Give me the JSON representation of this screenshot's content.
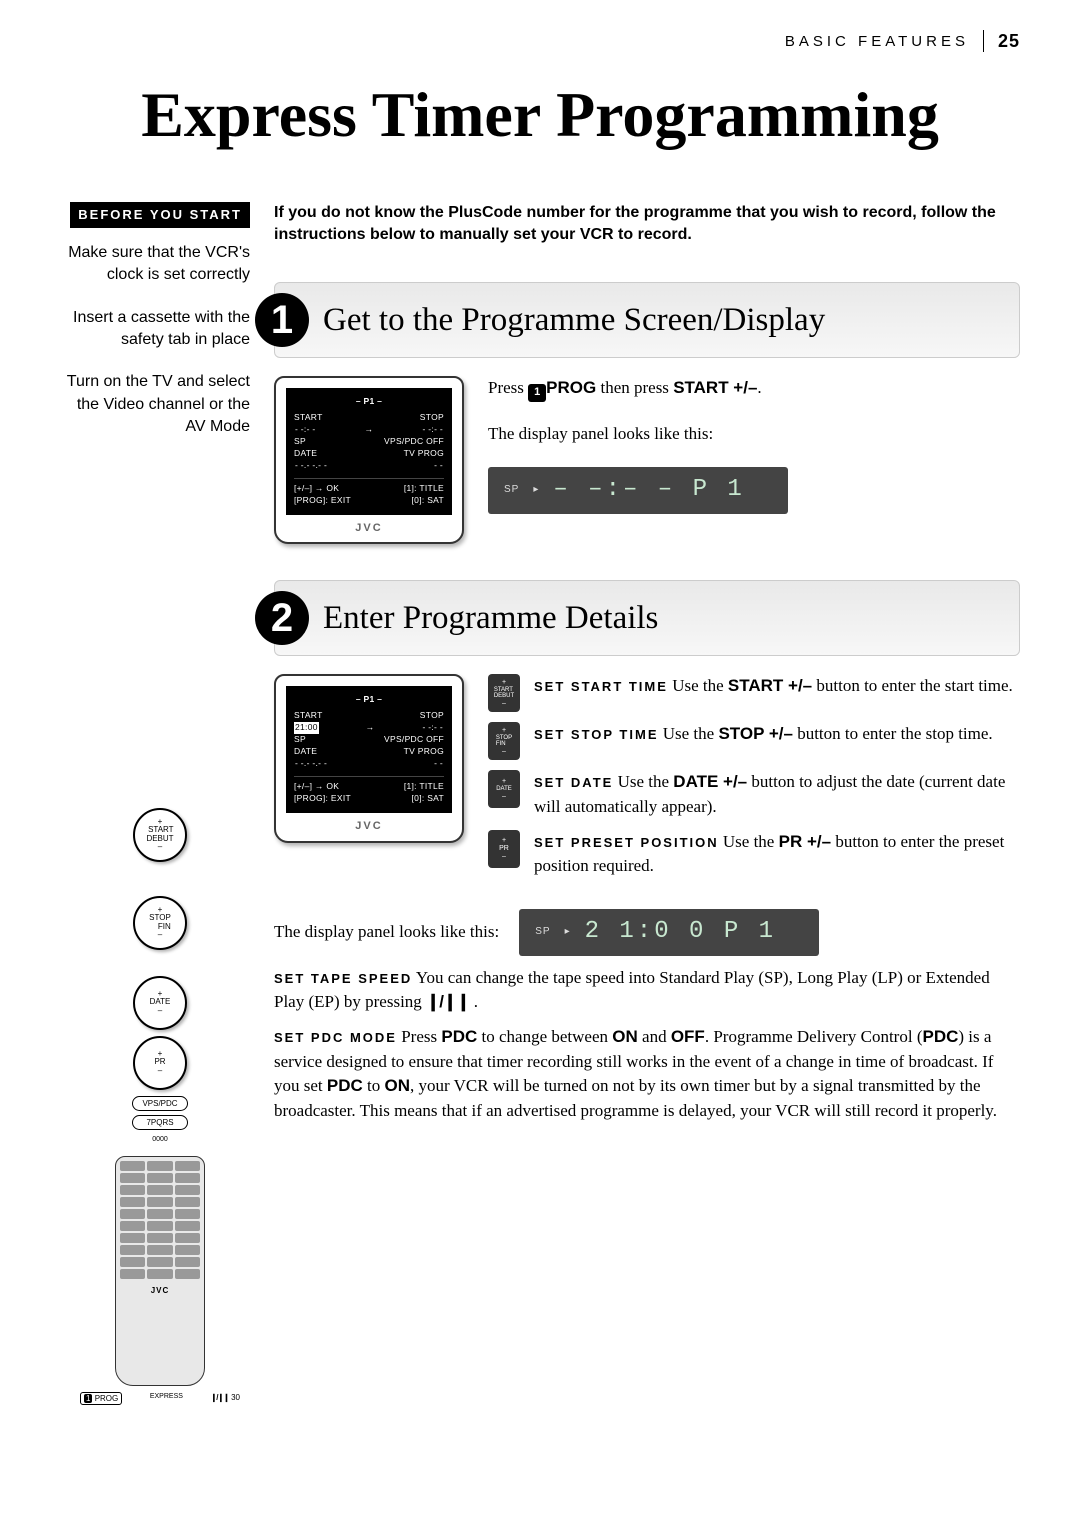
{
  "header": {
    "section": "BASIC FEATURES",
    "page": "25"
  },
  "title": "Express Timer Programming",
  "before": {
    "tag": "BEFORE YOU START",
    "p1": "Make sure that the VCR's clock is set correctly",
    "p2": "Insert a cassette with the safety tab in place",
    "p3": "Turn on the TV and select the Video channel or the AV Mode"
  },
  "intro": "If you do not know the PlusCode number for the programme that you wish to record, follow the instructions below to manually set your VCR to record.",
  "step1": {
    "num": "1",
    "title": "Get to the Programme Screen/Display",
    "press_a": "Press ",
    "prog_label": "PROG",
    "press_b": " then press ",
    "start_pm": "START +/–",
    "press_c": ".",
    "display_label": "The display panel looks like this:",
    "panel_sp": "SP",
    "panel_val": "– –:– –  P 1"
  },
  "tv1": {
    "header": "– P1 –",
    "start_l": "START",
    "stop_l": "STOP",
    "start_v": "- -:- -",
    "stop_v": "- -:- -",
    "sp": "SP",
    "vps": "VPS/PDC OFF",
    "date_l": "DATE",
    "tvprog": "TV PROG",
    "date_v": "- -.- -.- -",
    "tvprog_v": "- -",
    "hint1a": "[+/–] → OK",
    "hint1b": "[1]: TITLE",
    "hint2a": "[PROG]: EXIT",
    "hint2b": "[0]: SAT",
    "logo": "JVC"
  },
  "step2": {
    "num": "2",
    "title": "Enter Programme Details",
    "display_label": "The display panel looks like this:",
    "panel_sp": "SP",
    "panel_val": "2 1:0 0  P 1"
  },
  "tv2": {
    "header": "– P1 –",
    "start_v": "21:00"
  },
  "details": {
    "start": {
      "label": "SET START TIME",
      "text": "  Use the ",
      "btn": "START +/–",
      "rest": " button to enter the start time."
    },
    "stop": {
      "label": "SET STOP TIME",
      "text": "  Use the ",
      "btn": "STOP +/–",
      "rest": " button to enter the stop time."
    },
    "date": {
      "label": "SET DATE",
      "text": "  Use the ",
      "btn": "DATE +/–",
      "rest": " button to adjust the date (current date will automatically appear)."
    },
    "pr": {
      "label": "SET PRESET POSITION",
      "text": "  Use the ",
      "btn": "PR +/–",
      "rest": " button to enter the preset position required."
    }
  },
  "tape": {
    "label": "SET TAPE SPEED",
    "text": "  You can change the tape speed into Standard Play (SP), Long Play (LP) or Extended Play (EP) by pressing ",
    "icon": "❙/❙❙",
    "end": " ."
  },
  "pdc": {
    "label": "SET PDC MODE",
    "a": "  Press ",
    "btn": "PDC",
    "b": " to change between ",
    "on": "ON",
    "c": " and ",
    "off": "OFF",
    "d": ". Programme Delivery Control (",
    "pdc2": "PDC",
    "e": ") is a service designed to ensure that timer recording still works in the event of a change in time of broadcast. If you set ",
    "pdc3": "PDC",
    "f": " to ",
    "on2": "ON",
    "g": ", your VCR will be turned on not by its own timer but by a signal transmitted by the broadcaster. This means that if an advertised programme is delayed, your VCR will still record it properly."
  },
  "mini": {
    "start_top": "+",
    "start_mid": "START\nDEBUT",
    "start_bot": "–",
    "stop_top": "+",
    "stop_mid": "STOP\nFIN",
    "stop_bot": "–",
    "date_top": "+",
    "date_mid": "DATE",
    "date_bot": "–",
    "pr_top": "+",
    "pr_mid": "PR",
    "pr_bot": "–"
  },
  "remote": {
    "vpspdc": "VPS/PDC",
    "seven": "7PQRS",
    "zeros": "0000",
    "logo": "JVC",
    "prog": "PROG",
    "thirty": "30",
    "express": "EXPRESS"
  }
}
